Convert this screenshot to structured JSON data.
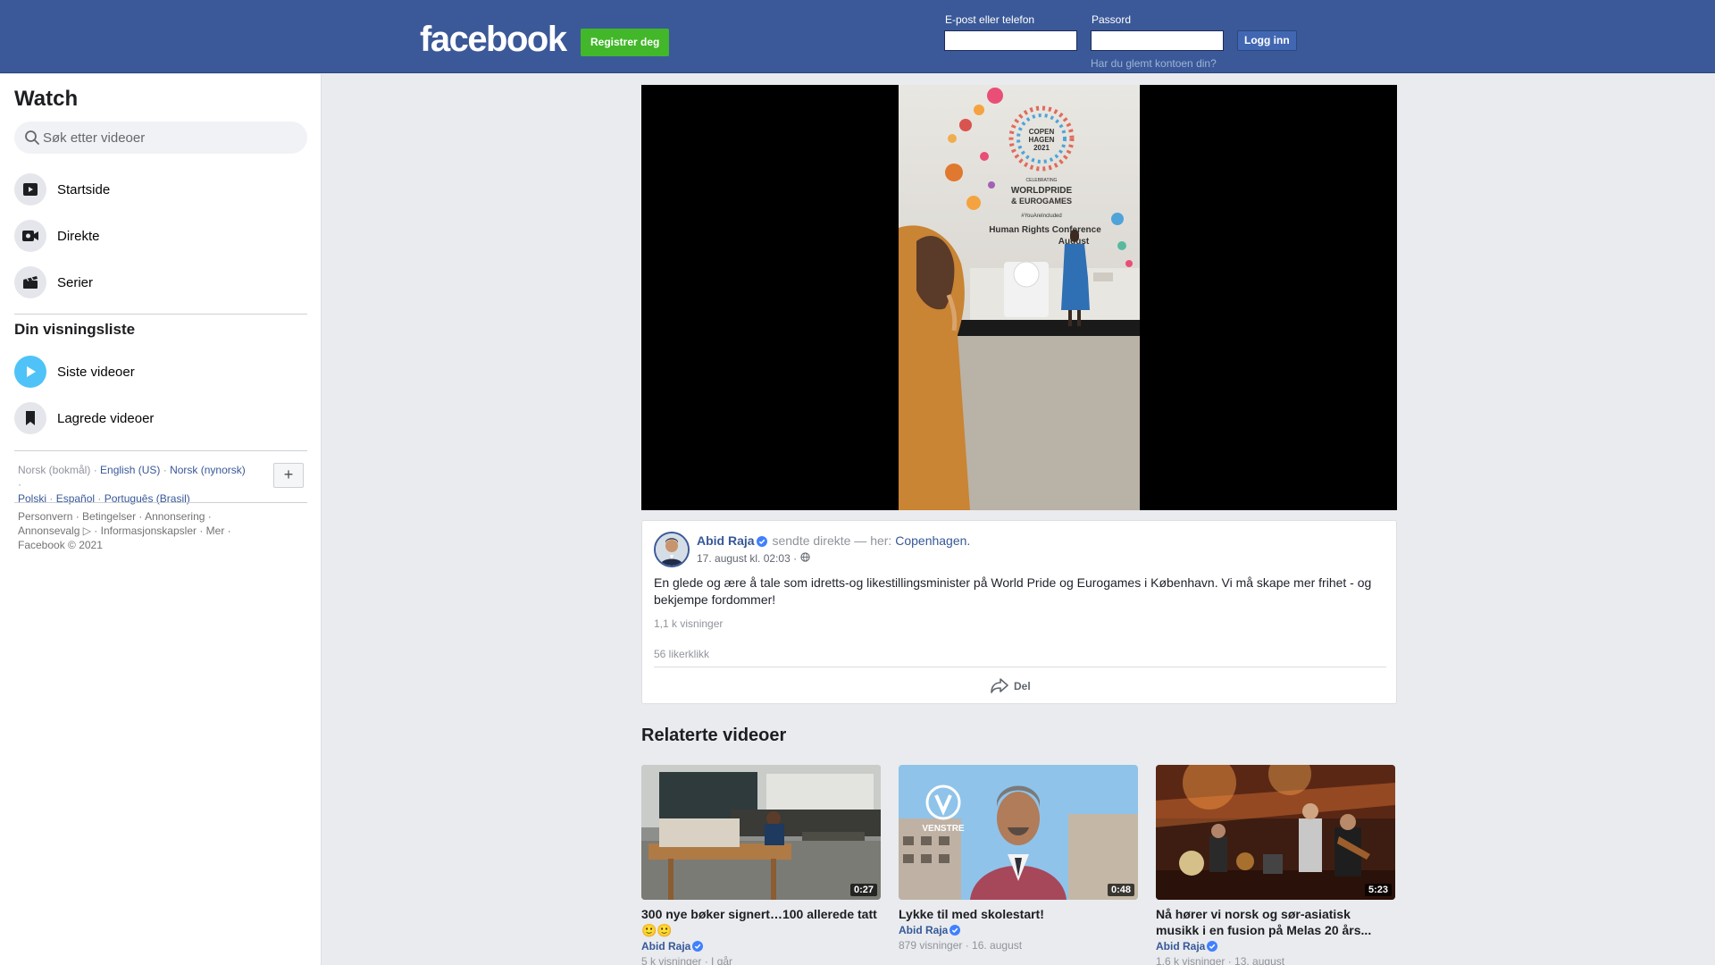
{
  "header": {
    "logo": "facebook",
    "register_label": "Registrer deg",
    "email_label": "E-post eller telefon",
    "password_label": "Passord",
    "login_label": "Logg inn",
    "forgot_label": "Har du glemt kontoen din?",
    "brand_color": "#3b5998"
  },
  "sidebar": {
    "title": "Watch",
    "search_placeholder": "Søk etter videoer",
    "nav": [
      {
        "label": "Startside",
        "icon": "play-screen-icon"
      },
      {
        "label": "Direkte",
        "icon": "live-camera-icon"
      },
      {
        "label": "Serier",
        "icon": "clapperboard-icon"
      }
    ],
    "watchlist_title": "Din visningsliste",
    "watchlist": [
      {
        "label": "Siste videoer",
        "icon": "play-circle-icon",
        "color": "#4fc3f7"
      },
      {
        "label": "Lagrede videoer",
        "icon": "bookmark-icon"
      }
    ],
    "languages": {
      "current": "Norsk (bokmål)",
      "links": [
        "English (US)",
        "Norsk (nynorsk)",
        "Polski",
        "Español",
        "Português (Brasil)"
      ]
    },
    "plus_label": "+",
    "footer": {
      "line1": "Personvern · Betingelser · Annonsering ·",
      "line2": "Annonsevalg ▷ · Informasjonskapsler · Mer ·",
      "line3": "Facebook © 2021"
    }
  },
  "video": {
    "author": "Abid Raja",
    "action": "sendte direkte — her:",
    "location": "Copenhagen.",
    "time": "17. august kl. 02:03 ·",
    "text": "En glede og ære å tale som idretts-og likestillingsminister på World Pride og Eurogames i København. Vi må skape mer frihet - og bekjempe fordommer!",
    "views": "1,1 k visninger",
    "likes": "56 likerklikk",
    "share_label": "Del",
    "banner": {
      "line1": "COPEN",
      "line2": "HAGEN",
      "line3": "2021",
      "line4": "CELEBRATING",
      "line5": "WORLDPRIDE",
      "line6": "& EUROGAMES",
      "line7": "#YouAreIncluded",
      "line8": "Human Rights Conference",
      "line9": "August"
    }
  },
  "related": {
    "title": "Relaterte videoer",
    "items": [
      {
        "title": "300 nye bøker signert…100 allerede tatt 🙂🙂",
        "author": "Abid Raja",
        "meta": "5 k visninger · I går",
        "duration": "0:27"
      },
      {
        "title": "Lykke til med skolestart!",
        "author": "Abid Raja",
        "meta": "879 visninger · 16. august",
        "duration": "0:48",
        "brand": "VENSTRE"
      },
      {
        "title": "Nå hører vi norsk og sør-asiatisk musikk i en fusion på Melas 20 års...",
        "author": "Abid Raja",
        "meta": "1,6 k visninger · 13. august",
        "duration": "5:23"
      }
    ]
  }
}
